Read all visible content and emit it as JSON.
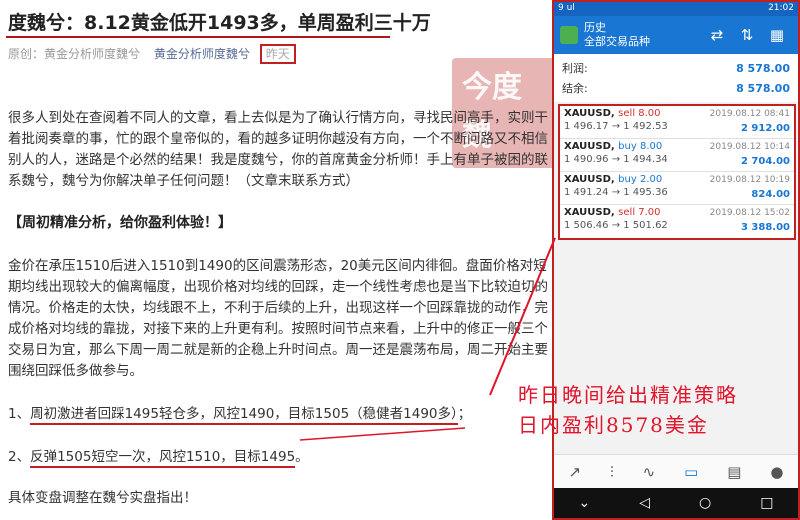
{
  "article": {
    "title": "度魏兮：8.12黄金低开1493多，单周盈利三十万",
    "meta_label": "原创：黄金分析师度魏兮",
    "meta_author": "黄金分析师度魏兮",
    "meta_date": "昨天",
    "para1": "很多人到处在查阅着不同人的文章，看上去似是为了确认行情方向，寻找民间高手，实则干着批阅奏章的事，忙的跟个皇帝似的，看的越多证明你越没有方向，一个不断问路又不相信别人的人，迷路是个必然的结果！我是度魏兮，你的首席黄金分析师！手上有单子被困的联系魏兮，魏兮为你解决单子任何问题！（文章末联系方式）",
    "heading": "【周初精准分析，给你盈利体验！】",
    "para2": "金价在承压1510后进入1510到1490的区间震荡形态，20美元区间内徘徊。盘面价格对短期均线出现较大的偏离幅度，出现价格对均线的回踩，走一个线性考虑也是当下比较迫切的情况。价格走的太快，均线跟不上，不利于后续的上升，出现这样一个回踩靠拢的动作，完成价格对均线的靠拢，对接下来的上升更有利。按照时间节点来看，上升中的修正一般三个交易日为宜，那么下周一周二就是新的企稳上升时间点。周一还是震荡布局，周二开始主要围绕回踩低多做参与。",
    "item1_prefix": "1、",
    "item1": "周初激进者回踩1495轻仓多，风控1490，目标1505（稳健者1490多）",
    "item1_suffix": "；",
    "item2_prefix": "2、",
    "item2": "反弹1505短空一次，风控1510，目标1495",
    "item2_suffix": "。",
    "para3": "具体变盘调整在魏兮实盘指出！",
    "watermark": [
      "今度",
      "魏"
    ],
    "annotation_line1": "昨日晚间给出精准策略",
    "annotation_line2": "日内盈利8578美金"
  },
  "phone": {
    "status_left": "9 ul",
    "status_time": "21:02",
    "app_title": "历史",
    "app_subtitle": "全部交易品种",
    "summary": [
      {
        "label": "利润:",
        "value": "8 578.00"
      },
      {
        "label": "结余:",
        "value": "8 578.00"
      }
    ],
    "trades": [
      {
        "symbol": "XAUUSD,",
        "dir": "sell 8.00",
        "type": "sell",
        "time": "2019.08.12 08:41",
        "prices": "1 496.17 → 1 492.53",
        "profit": "2 912.00"
      },
      {
        "symbol": "XAUUSD,",
        "dir": "buy 8.00",
        "type": "buy",
        "time": "2019.08.12 10:14",
        "prices": "1 490.96 → 1 494.34",
        "profit": "2 704.00"
      },
      {
        "symbol": "XAUUSD,",
        "dir": "buy 2.00",
        "type": "buy",
        "time": "2019.08.12 10:19",
        "prices": "1 491.24 → 1 495.36",
        "profit": "824.00"
      },
      {
        "symbol": "XAUUSD,",
        "dir": "sell 7.00",
        "type": "sell",
        "time": "2019.08.12 15:02",
        "prices": "1 506.46 → 1 501.62",
        "profit": "3 388.00"
      }
    ]
  }
}
